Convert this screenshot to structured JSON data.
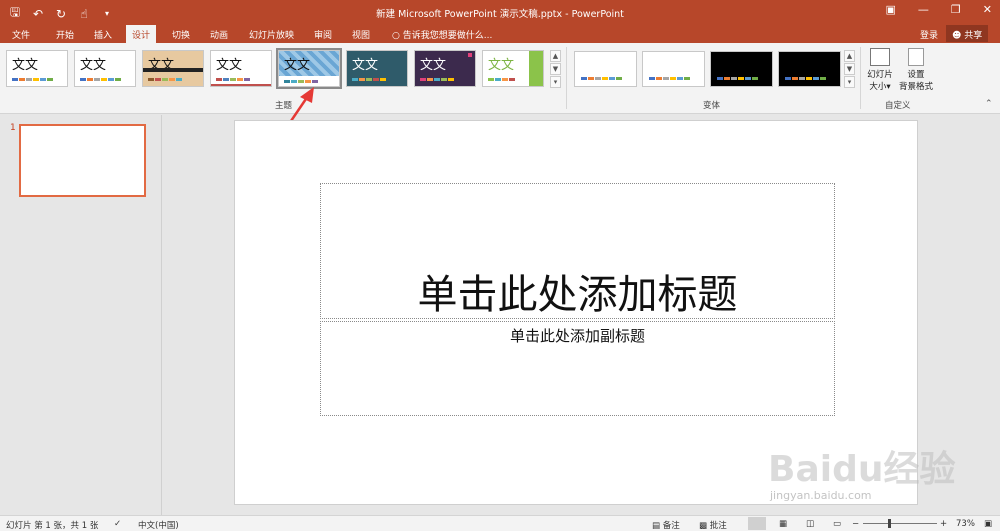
{
  "titlebar": {
    "title": "新建 Microsoft PowerPoint 演示文稿.pptx - PowerPoint",
    "bg_color": "#b7472a"
  },
  "quick_access": {
    "icons": [
      "save-icon",
      "undo-icon",
      "redo-icon",
      "touch-mode-icon",
      "customize-qat-icon"
    ]
  },
  "tabs": [
    {
      "label": "文件"
    },
    {
      "label": "开始"
    },
    {
      "label": "插入"
    },
    {
      "label": "设计"
    },
    {
      "label": "切换"
    },
    {
      "label": "动画"
    },
    {
      "label": "幻灯片放映"
    },
    {
      "label": "审阅"
    },
    {
      "label": "视图"
    }
  ],
  "active_tab": "设计",
  "tell_me": "告诉我您想要做什么...",
  "account": {
    "login": "登录",
    "share": "共享"
  },
  "ribbon": {
    "themes_group_label": "主题",
    "themes": [
      {
        "sample": "文文",
        "bg": "#ffffff"
      },
      {
        "sample": "文文",
        "bg": "#ffffff"
      },
      {
        "sample": "文文",
        "bg": "#e7c9a0"
      },
      {
        "sample": "文文",
        "bg": "#ffffff"
      },
      {
        "sample": "文文",
        "bg": "#9ec8e6"
      },
      {
        "sample": "文文",
        "bg": "#2f5b6a"
      },
      {
        "sample": "文文",
        "bg": "#3c2a4d"
      },
      {
        "sample": "文文",
        "bg": "#ffffff"
      }
    ],
    "variants_group_label": "变体",
    "variants": [
      {
        "bg": "#ffffff"
      },
      {
        "bg": "#ffffff"
      },
      {
        "bg": "#000000"
      },
      {
        "bg": "#000000"
      }
    ],
    "customize_group_label": "自定义",
    "slide_size_label_1": "幻灯片",
    "slide_size_label_2": "大小",
    "format_bg_label_1": "设置",
    "format_bg_label_2": "背景格式"
  },
  "thumbnails": [
    {
      "number": "1"
    }
  ],
  "slide": {
    "title_placeholder": "单击此处添加标题",
    "subtitle_placeholder": "单击此处添加副标题"
  },
  "statusbar": {
    "slide_info": "幻灯片 第 1 张，共 1 张",
    "language": "中文(中国)",
    "notes": "备注",
    "comments": "批注",
    "zoom": "73%"
  },
  "watermark": {
    "brand": "Baidu经验",
    "url": "jingyan.baidu.com"
  }
}
